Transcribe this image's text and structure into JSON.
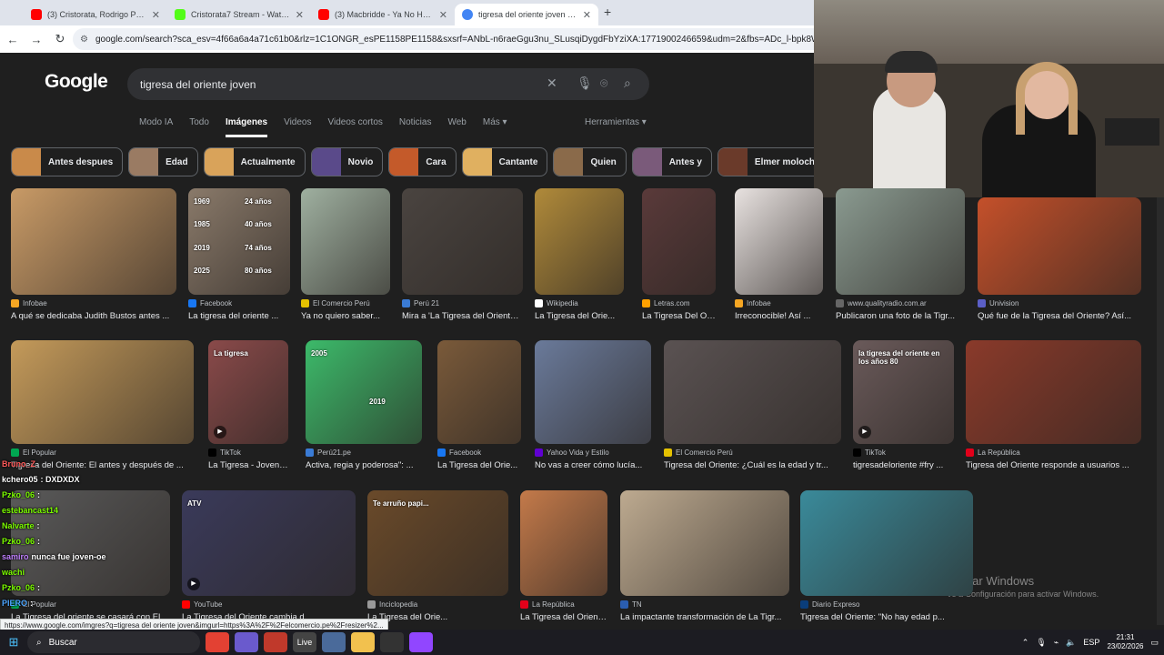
{
  "browser": {
    "tabs": [
      {
        "label": "(3) Cristorata, Rodrigo Puente -",
        "color": "#ff0000"
      },
      {
        "label": "Cristorata7 Stream - Watch Live",
        "color": "#53fc18"
      },
      {
        "label": "(3) Macbridde - Ya No Hay Nad",
        "color": "#ff0000"
      },
      {
        "label": "tigresa del oriente joven - Busc",
        "color": "#4285f4"
      }
    ],
    "new_tab": "+",
    "url": "google.com/search?sca_esv=4f66a6a4a71c61b0&rlz=1C1ONGR_esPE1158PE1158&sxsrf=ANbL-n6raeGgu3nu_SLusqiDygdFbYziXA:1771900246659&udm=2&fbs=ADc_l-bpk8W4E-qsVlOvbGJcD"
  },
  "google": {
    "logo": "Google",
    "query": "tigresa del oriente joven",
    "tabs": [
      "Modo IA",
      "Todo",
      "Imágenes",
      "Videos",
      "Videos cortos",
      "Noticias",
      "Web",
      "Más ▾"
    ],
    "active_tab": "Imágenes",
    "tools": "Herramientas ▾"
  },
  "chips": [
    {
      "label": "Antes despues",
      "color": "#c98a4a"
    },
    {
      "label": "Edad",
      "color": "#9a7b63"
    },
    {
      "label": "Actualmente",
      "color": "#d9a35a"
    },
    {
      "label": "Novio",
      "color": "#5a4a8a"
    },
    {
      "label": "Cara",
      "color": "#c45a2a"
    },
    {
      "label": "Cantante",
      "color": "#e0b060"
    },
    {
      "label": "Quien",
      "color": "#8a6a4a"
    },
    {
      "label": "Antes y",
      "color": "#7a5a7a"
    },
    {
      "label": "Elmer molocho",
      "color": "#6a3a2a"
    }
  ],
  "results": [
    {
      "source": "Infobae",
      "title": "A qué se dedicaba Judith Bustos antes ...",
      "color": "#c89a66",
      "src_color": "#f5a623"
    },
    {
      "source": "Facebook",
      "title": "La tigresa del oriente ...",
      "color": "#8a7a6a",
      "src_color": "#1877f2",
      "overlay": [
        "1969",
        "24 años",
        "1985",
        "40 años",
        "2019",
        "74 años",
        "2025",
        "80 años"
      ]
    },
    {
      "source": "El Comercio Perú",
      "title": "Ya no quiero saber...",
      "color": "#9fb0a0",
      "src_color": "#e5c100"
    },
    {
      "source": "Perú 21",
      "title": "Mira a 'La Tigresa del Oriente ...",
      "color": "#4a4440",
      "src_color": "#3a7bd5"
    },
    {
      "source": "Wikipedia",
      "title": "La Tigresa del Orie...",
      "color": "#b08a3a",
      "src_color": "#ffffff"
    },
    {
      "source": "Letras.com",
      "title": "La Tigresa Del Ori...",
      "color": "#5a3a3a",
      "src_color": "#ffa000"
    },
    {
      "source": "Infobae",
      "title": "Irreconocible! Así ...",
      "color": "#e8e2e0",
      "src_color": "#f5a623"
    },
    {
      "source": "www.qualityradio.com.ar",
      "title": "Publicaron una foto de la Tigr...",
      "color": "#8a9a90",
      "src_color": "#666666"
    },
    {
      "source": "Univision",
      "title": "Qué fue de la Tigresa del Oriente? Así...",
      "color": "#c4502a",
      "src_color": "#5b5fc7"
    },
    {
      "source": "El Popular",
      "title": "Tigresa del Oriente: El antes y después de ...",
      "color": "#c49a5a",
      "src_color": "#00a651"
    },
    {
      "source": "TikTok",
      "title": "La Tigresa - Joven,...",
      "color": "#8a4a4a",
      "src_color": "#000000",
      "overlay": [
        "La tigresa"
      ]
    },
    {
      "source": "Perú21.pe",
      "title": "Activa, regia y poderosa\": ...",
      "color": "#3cba6a",
      "src_color": "#3a7bd5",
      "overlay": [
        "2005",
        "2019"
      ]
    },
    {
      "source": "Facebook",
      "title": "La Tigresa del Orie...",
      "color": "#7a5a3a",
      "src_color": "#1877f2"
    },
    {
      "source": "Yahoo Vida y Estilo",
      "title": "No vas a creer cómo lucía...",
      "color": "#6a7a9a",
      "src_color": "#6001d2"
    },
    {
      "source": "El Comercio Perú",
      "title": "Tigresa del Oriente: ¿Cuál es la edad y tr...",
      "color": "#5a5252",
      "src_color": "#e5c100"
    },
    {
      "source": "TikTok",
      "title": "tigresadeloriente #fry ...",
      "color": "#6a5a5a",
      "src_color": "#000000",
      "overlay": [
        "la tigresa del oriente en los años 80"
      ]
    },
    {
      "source": "La República",
      "title": "Tigresa del Oriente responde a usuarios ...",
      "color": "#8a3a2a",
      "src_color": "#e2001a"
    },
    {
      "source": "El Popular",
      "title": "La Tigresa del oriente se casará con Elm...",
      "color": "#5a5a5a",
      "src_color": "#00a651"
    },
    {
      "source": "YouTube",
      "title": "La Tigresa del Oriente cambia d...",
      "color": "#3a3a5a",
      "src_color": "#ff0000",
      "overlay": [
        "ATV"
      ]
    },
    {
      "source": "Inciclopedia",
      "title": "La Tigresa del Orie...",
      "color": "#6a4a2a",
      "src_color": "#999999",
      "overlay": [
        "Te arruño papi..."
      ]
    },
    {
      "source": "La República",
      "title": "La Tigresa del Oriente y la vez que fue ...",
      "color": "#c47a4a",
      "src_color": "#e2001a"
    },
    {
      "source": "TN",
      "title": "La impactante transformación de La Tigr...",
      "color": "#bdaa90",
      "src_color": "#2a5db0"
    },
    {
      "source": "Diario Expreso",
      "title": "Tigresa del Oriente: \"No hay edad p...",
      "color": "#3a8a9a",
      "src_color": "#0a3d7a"
    }
  ],
  "chat": [
    {
      "user": "Bruno_Z",
      "text": "",
      "color": "#ff5a5a"
    },
    {
      "user": "kchero05",
      "text": ": DXDXDX",
      "color": "#ffffff"
    },
    {
      "user": "Pzko_06",
      "text": ":",
      "color": "#7cfc00"
    },
    {
      "user": "estebancast14",
      "text": "",
      "color": "#7cfc00"
    },
    {
      "user": "Nalvarte",
      "text": ":",
      "color": "#7cfc00"
    },
    {
      "user": "Pzko_06",
      "text": ":",
      "color": "#7cfc00"
    },
    {
      "user": "samiro",
      "text": "nunca fue joven-oe",
      "color": "#c080ff"
    },
    {
      "user": "wachi",
      "text": "",
      "color": "#7cfc00"
    },
    {
      "user": "Pzko_06",
      "text": ":",
      "color": "#7cfc00"
    },
    {
      "user": "PIERO",
      "text": ":",
      "color": "#4da6ff"
    },
    {
      "user": "",
      "text": "",
      "color": "#ffffff"
    },
    {
      "user": "NaomiiiJ",
      "text": "",
      "color": "#7cfc00"
    }
  ],
  "status_url": "https://www.google.com/imgres?q=tigresa del oriente joven&imgurl=https%3A%2F%2Felcomercio.pe%2Fresizer%2...",
  "watermark": {
    "title": "Activar Windows",
    "subtitle": "Ve a Configuración para activar Windows."
  },
  "taskbar": {
    "search": "Buscar",
    "icons": [
      {
        "name": "chrome-icon",
        "color": "#e34133"
      },
      {
        "name": "copilot-icon",
        "color": "#6a5acd"
      },
      {
        "name": "app-icon",
        "color": "#c0392b"
      },
      {
        "name": "live-icon",
        "color": "#444"
      },
      {
        "name": "app2-icon",
        "color": "#4a6a9a"
      },
      {
        "name": "folder-icon",
        "color": "#f2c14e"
      },
      {
        "name": "obs-icon",
        "color": "#333"
      },
      {
        "name": "twitch-icon",
        "color": "#9146ff"
      }
    ],
    "live_label": "Live",
    "lang": "ESP",
    "time": "21:31",
    "date": "23/02/2026"
  },
  "colors": {
    "google_dark": "#1f1f1f",
    "accent": "#8ab4f8"
  }
}
